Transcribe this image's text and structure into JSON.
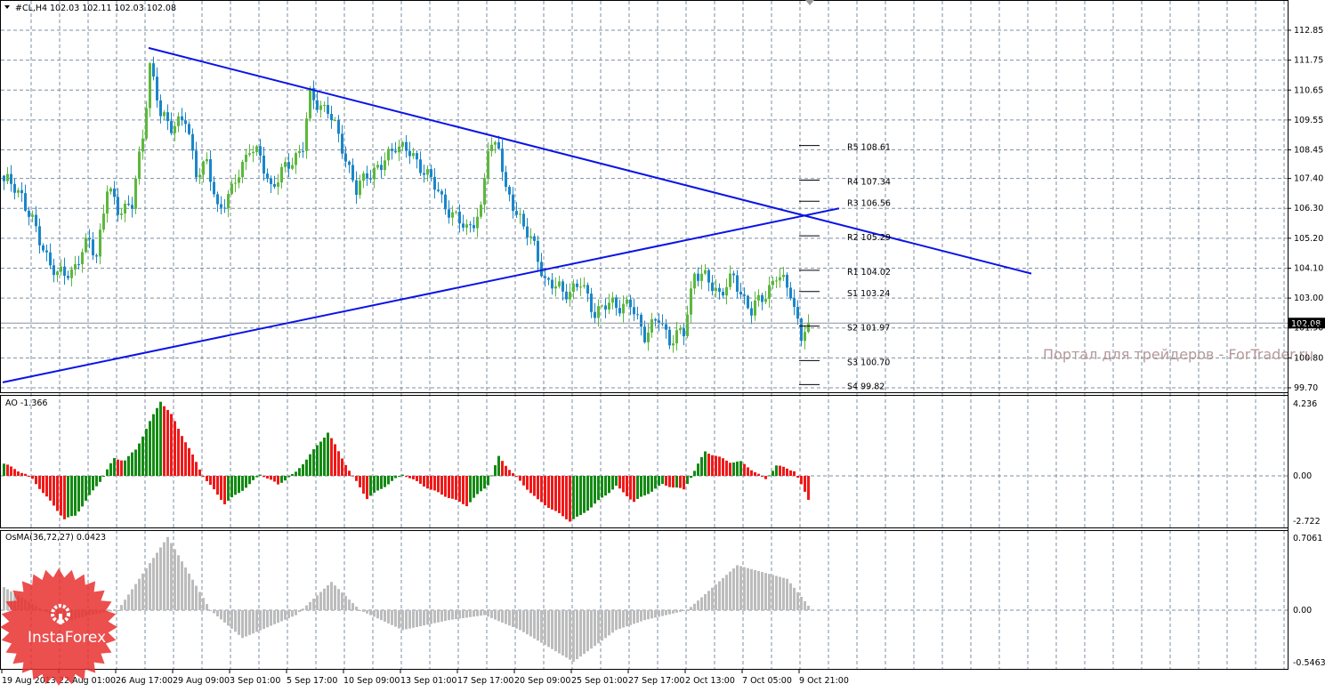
{
  "header": {
    "symbol": "#CL,H4",
    "ohlc": "102.03 102.11 102.03 102.08"
  },
  "watermark": "Портал для трейдеров - ForTrader.ru",
  "logo": "InstaForex",
  "colors": {
    "bull": "#5cb83c",
    "bear": "#1a86c9",
    "trend": "#0a14e6",
    "ao_up": "#138a13",
    "ao_down": "#f01818",
    "osma": "#bcbcbc",
    "grid": "#7d8fa2"
  },
  "chart_data": [
    {
      "type": "candlestick",
      "title": "#CL,H4",
      "ylim": [
        99.7,
        112.85
      ],
      "yticks": [
        "112.85",
        "111.75",
        "110.65",
        "109.55",
        "108.45",
        "107.40",
        "106.30",
        "105.20",
        "104.10",
        "103.00",
        "101.90",
        "100.80",
        "99.70"
      ],
      "current_price": "102.08",
      "xticks": [
        "19 Aug 2013",
        "22 Aug 01:00",
        "26 Aug 17:00",
        "29 Aug 09:00",
        "3 Sep 01:00",
        "5 Sep 17:00",
        "10 Sep 09:00",
        "13 Sep 01:00",
        "17 Sep 17:00",
        "20 Sep 09:00",
        "25 Sep 01:00",
        "27 Sep 17:00",
        "2 Oct 13:00",
        "7 Oct 05:00",
        "9 Oct 21:00"
      ],
      "bars_per_xtick": 16,
      "close_anchors": [
        [
          0,
          107.3
        ],
        [
          1,
          107.25
        ],
        [
          5,
          106.8
        ],
        [
          10,
          105.1
        ],
        [
          15,
          103.8
        ],
        [
          19,
          104
        ],
        [
          24,
          105.1
        ],
        [
          26,
          104.6
        ],
        [
          29,
          107
        ],
        [
          32,
          106.3
        ],
        [
          36,
          106.4
        ],
        [
          39,
          109
        ],
        [
          41,
          111.6
        ],
        [
          44,
          109.7
        ],
        [
          47,
          109.4
        ],
        [
          51,
          109.5
        ],
        [
          54,
          107.7
        ],
        [
          57,
          107.9
        ],
        [
          60,
          106.3
        ],
        [
          64,
          106.9
        ],
        [
          69,
          108.6
        ],
        [
          72,
          108.1
        ],
        [
          75,
          107.1
        ],
        [
          80,
          107.9
        ],
        [
          84,
          108.6
        ],
        [
          86,
          110.4
        ],
        [
          91,
          109.9
        ],
        [
          95,
          108.6
        ],
        [
          99,
          106.9
        ],
        [
          102,
          107.6
        ],
        [
          106,
          107.8
        ],
        [
          110,
          108.7
        ],
        [
          114,
          108.3
        ],
        [
          117,
          107.9
        ],
        [
          122,
          106.9
        ],
        [
          126,
          106
        ],
        [
          130,
          105.6
        ],
        [
          134,
          106.1
        ],
        [
          136,
          108.6
        ],
        [
          139,
          108.7
        ],
        [
          141,
          106.8
        ],
        [
          145,
          106
        ],
        [
          149,
          104.8
        ],
        [
          152,
          103.7
        ],
        [
          157,
          103.2
        ],
        [
          162,
          103.5
        ],
        [
          166,
          102.5
        ],
        [
          171,
          102.8
        ],
        [
          176,
          102.7
        ],
        [
          180,
          101.7
        ],
        [
          184,
          102.2
        ],
        [
          187,
          101.5
        ],
        [
          191,
          101.7
        ],
        [
          194,
          104
        ],
        [
          197,
          103.7
        ],
        [
          201,
          103.2
        ],
        [
          205,
          103.7
        ],
        [
          210,
          102.5
        ],
        [
          214,
          103.2
        ],
        [
          217,
          103.8
        ],
        [
          221,
          103.3
        ],
        [
          224,
          101.5
        ],
        [
          226,
          102.08
        ]
      ],
      "trendlines": [
        {
          "name": "descending",
          "from": [
            41,
            112.2
          ],
          "to": [
            289,
            103.9
          ]
        },
        {
          "name": "ascending",
          "from": [
            0,
            99.9
          ],
          "to": [
            235,
            106.3
          ]
        }
      ],
      "pivots": [
        {
          "label": "R5",
          "value": "108.61"
        },
        {
          "label": "R4",
          "value": "107.34"
        },
        {
          "label": "R3",
          "value": "106.56"
        },
        {
          "label": "R2",
          "value": "105.29"
        },
        {
          "label": "R1",
          "value": "104.02"
        },
        {
          "label": "S1",
          "value": "103.24"
        },
        {
          "label": "S2",
          "value": "101.97"
        },
        {
          "label": "S3",
          "value": "100.70"
        },
        {
          "label": "S4",
          "value": "99.82"
        }
      ]
    },
    {
      "type": "bar",
      "title": "AO -1.366",
      "ylim": [
        -2.722,
        4.236
      ],
      "yticks": [
        "4.236",
        "0.00",
        "-2.722"
      ],
      "anchors": [
        [
          0,
          0.7
        ],
        [
          6,
          0.1
        ],
        [
          8,
          -0.2
        ],
        [
          17,
          -2.5
        ],
        [
          20,
          -2.3
        ],
        [
          27,
          -0.3
        ],
        [
          31,
          1.0
        ],
        [
          34,
          0.9
        ],
        [
          37,
          1.5
        ],
        [
          44,
          4.3
        ],
        [
          47,
          3.5
        ],
        [
          55,
          0.4
        ],
        [
          57,
          -0.3
        ],
        [
          62,
          -1.6
        ],
        [
          69,
          -0.5
        ],
        [
          72,
          0.1
        ],
        [
          77,
          -0.5
        ],
        [
          82,
          0.2
        ],
        [
          91,
          2.5
        ],
        [
          97,
          0.3
        ],
        [
          102,
          -1.3
        ],
        [
          112,
          0.1
        ],
        [
          120,
          -0.8
        ],
        [
          130,
          -1.7
        ],
        [
          136,
          -0.5
        ],
        [
          139,
          1.1
        ],
        [
          144,
          -0.1
        ],
        [
          150,
          -1.4
        ],
        [
          159,
          -2.6
        ],
        [
          162,
          -2.3
        ],
        [
          172,
          -0.6
        ],
        [
          177,
          -1.5
        ],
        [
          185,
          -0.5
        ],
        [
          191,
          -0.8
        ],
        [
          197,
          1.4
        ],
        [
          204,
          0.8
        ],
        [
          207,
          0.8
        ],
        [
          214,
          -0.2
        ],
        [
          217,
          0.6
        ],
        [
          222,
          0.3
        ],
        [
          226,
          -1.366
        ]
      ]
    },
    {
      "type": "bar",
      "title": "OsMA(36,72,27) 0.0423",
      "ylim": [
        -0.5463,
        0.7061
      ],
      "yticks": [
        "0.7061",
        "0.00",
        "-0.5463"
      ],
      "anchors": [
        [
          0,
          0.22
        ],
        [
          7,
          0.08
        ],
        [
          17,
          -0.12
        ],
        [
          24,
          -0.05
        ],
        [
          32,
          0.0
        ],
        [
          46,
          0.7
        ],
        [
          58,
          0.0
        ],
        [
          67,
          -0.28
        ],
        [
          82,
          -0.05
        ],
        [
          92,
          0.27
        ],
        [
          100,
          0.0
        ],
        [
          112,
          -0.2
        ],
        [
          125,
          -0.1
        ],
        [
          135,
          -0.05
        ],
        [
          145,
          -0.2
        ],
        [
          160,
          -0.52
        ],
        [
          172,
          -0.2
        ],
        [
          180,
          -0.1
        ],
        [
          192,
          0.0
        ],
        [
          206,
          0.43
        ],
        [
          220,
          0.3
        ],
        [
          226,
          0.0423
        ]
      ]
    }
  ]
}
